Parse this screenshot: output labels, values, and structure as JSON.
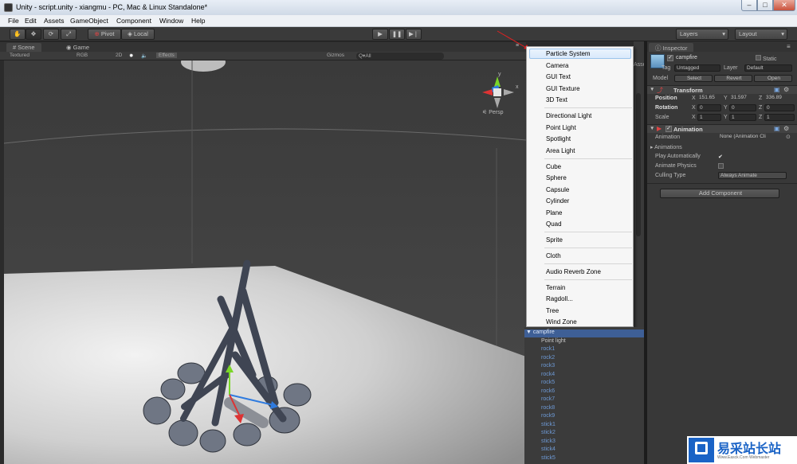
{
  "window": {
    "title": "Unity - script.unity - xiangmu - PC, Mac & Linux Standalone*",
    "minimize": "–",
    "maximize": "□",
    "close": "✕"
  },
  "menubar": [
    "File",
    "Edit",
    "Assets",
    "GameObject",
    "Component",
    "Window",
    "Help"
  ],
  "toolbar": {
    "pivot": "Pivot",
    "local": "Local",
    "layers": "Layers",
    "layout": "Layout"
  },
  "scene": {
    "tabs": [
      "Scene",
      "Game"
    ],
    "shading": "Textured",
    "render_mode": "RGB",
    "mode_2d": "2D",
    "effects": "Effects",
    "gizmos": "Gizmos",
    "search_placeholder": "Q▾All",
    "persp": "Persp",
    "axis_y": "y",
    "axis_x": "x"
  },
  "create_menu": {
    "items": [
      "Particle System",
      "Camera",
      "GUI Text",
      "GUI Texture",
      "3D Text",
      "Directional Light",
      "Point Light",
      "Spotlight",
      "Area Light",
      "Cube",
      "Sphere",
      "Capsule",
      "Cylinder",
      "Plane",
      "Quad",
      "Sprite",
      "Cloth",
      "Audio Reverb Zone",
      "Terrain",
      "Ragdoll...",
      "Tree",
      "Wind Zone"
    ],
    "highlighted": "Particle System"
  },
  "hierarchy": {
    "rows": [
      "campfire",
      "Point light",
      "rock1",
      "rock2",
      "rock3",
      "rock4",
      "rock5",
      "rock6",
      "rock7",
      "rock8",
      "rock9",
      "stick1",
      "stick2",
      "stick3",
      "stick4",
      "stick5"
    ],
    "partial_tab": "Asse"
  },
  "inspector": {
    "tab": "Inspector",
    "object_name": "campfire",
    "static_label": "Static",
    "tag_label": "Tag",
    "tag_value": "Untagged",
    "layer_label": "Layer",
    "layer_value": "Default",
    "model_label": "Model",
    "model_buttons": [
      "Select",
      "Revert",
      "Open"
    ],
    "transform": {
      "title": "Transform",
      "position_label": "Position",
      "position": {
        "x": "151.65",
        "y": "31.597",
        "z": "336.89"
      },
      "rotation_label": "Rotation",
      "rotation": {
        "x": "0",
        "y": "0",
        "z": "0"
      },
      "scale_label": "Scale",
      "scale": {
        "x": "1",
        "y": "1",
        "z": "1"
      }
    },
    "animation": {
      "title": "Animation",
      "animation_label": "Animation",
      "animation_value": "None (Animation Cli",
      "animations_label": "Animations",
      "play_auto_label": "Play Automatically",
      "play_auto": true,
      "animate_physics_label": "Animate Physics",
      "animate_physics": false,
      "culling_label": "Culling Type",
      "culling_value": "Always Animate"
    },
    "add_component": "Add Component"
  },
  "watermark": {
    "text": "易采站长站",
    "subtext": "Www.Easck.Com Webmaster"
  },
  "colors": {
    "editor_bg": "#383838",
    "selection": "#3e5f96",
    "hierarchy_text": "#6e9ad6",
    "menu_highlight": "#d9e9fb",
    "arrow_red": "#e02020"
  }
}
